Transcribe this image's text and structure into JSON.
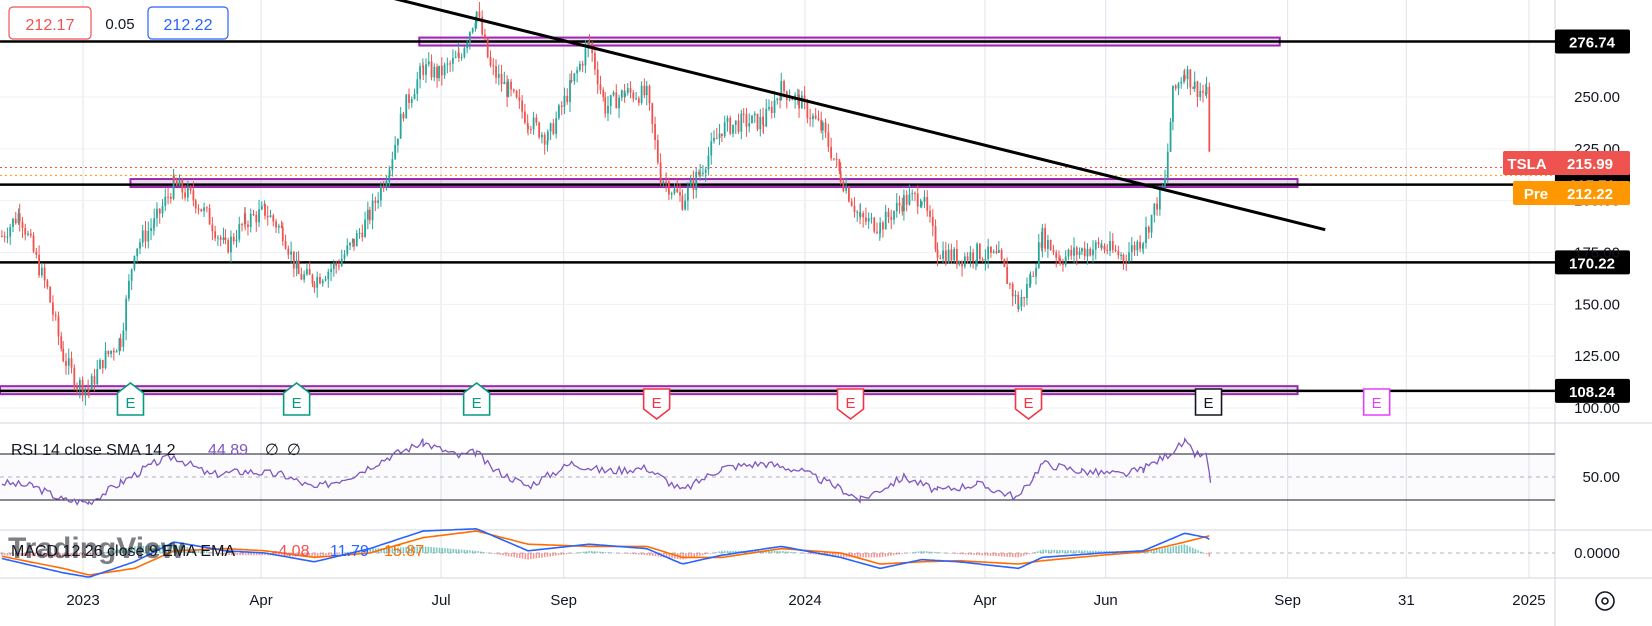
{
  "header": {
    "bid": "212.17",
    "spread": "0.05",
    "ask": "212.22"
  },
  "watermark": "TradingView",
  "colors": {
    "up": "#26a69a",
    "down": "#ef5350",
    "rsi": "#7e57c2",
    "macd": "#2962ff",
    "signal": "#ff6d00",
    "zone": "#9c27b0",
    "earnings_past_green": "#089981",
    "earnings_past_red": "#f23645",
    "earnings_future": "#e040fb"
  },
  "chart_data": [
    {
      "type": "candlestick",
      "symbol": "TSLA",
      "x_axis_labels": [
        "2023",
        "Apr",
        "Jul",
        "Sep",
        "2024",
        "Apr",
        "Jun",
        "Sep",
        "31",
        "2025"
      ],
      "y_ticks": [
        100,
        125,
        150,
        175,
        200,
        225,
        250
      ],
      "y_tick_labels": [
        "100.00",
        "125.00",
        "150.00",
        "175.00",
        "200.00",
        "225.00",
        "250.00"
      ],
      "ylim": [
        95,
        295
      ],
      "last_price_label": "215.99",
      "premarket_label": "Pre",
      "premarket_price": "212.22",
      "price_path": [
        [
          "2022-11-21",
          183
        ],
        [
          "2022-11-30",
          194
        ],
        [
          "2022-12-07",
          175
        ],
        [
          "2022-12-14",
          157
        ],
        [
          "2022-12-22",
          125
        ],
        [
          "2022-12-29",
          112
        ],
        [
          "2023-01-04",
          109
        ],
        [
          "2023-01-11",
          123
        ],
        [
          "2023-01-20",
          133
        ],
        [
          "2023-01-27",
          177
        ],
        [
          "2023-02-06",
          189
        ],
        [
          "2023-02-16",
          208
        ],
        [
          "2023-02-27",
          200
        ],
        [
          "2023-03-06",
          191
        ],
        [
          "2023-03-14",
          177
        ],
        [
          "2023-03-24",
          190
        ],
        [
          "2023-04-03",
          195
        ],
        [
          "2023-04-12",
          185
        ],
        [
          "2023-04-20",
          164
        ],
        [
          "2023-04-28",
          162
        ],
        [
          "2023-05-09",
          169
        ],
        [
          "2023-05-18",
          180
        ],
        [
          "2023-05-26",
          193
        ],
        [
          "2023-06-05",
          217
        ],
        [
          "2023-06-12",
          244
        ],
        [
          "2023-06-22",
          264
        ],
        [
          "2023-06-30",
          261
        ],
        [
          "2023-07-10",
          269
        ],
        [
          "2023-07-19",
          291
        ],
        [
          "2023-07-26",
          264
        ],
        [
          "2023-08-04",
          253
        ],
        [
          "2023-08-14",
          239
        ],
        [
          "2023-08-24",
          230
        ],
        [
          "2023-09-05",
          256
        ],
        [
          "2023-09-14",
          276
        ],
        [
          "2023-09-22",
          245
        ],
        [
          "2023-10-02",
          252
        ],
        [
          "2023-10-13",
          251
        ],
        [
          "2023-10-20",
          212
        ],
        [
          "2023-10-31",
          200
        ],
        [
          "2023-11-09",
          214
        ],
        [
          "2023-11-20",
          235
        ],
        [
          "2023-12-01",
          238
        ],
        [
          "2023-12-11",
          238
        ],
        [
          "2023-12-20",
          254
        ],
        [
          "2023-12-29",
          248
        ],
        [
          "2024-01-10",
          234
        ],
        [
          "2024-01-19",
          212
        ],
        [
          "2024-01-29",
          191
        ],
        [
          "2024-02-08",
          188
        ],
        [
          "2024-02-20",
          200
        ],
        [
          "2024-02-29",
          202
        ],
        [
          "2024-03-08",
          176
        ],
        [
          "2024-03-19",
          172
        ],
        [
          "2024-03-28",
          175
        ],
        [
          "2024-04-08",
          172
        ],
        [
          "2024-04-18",
          149
        ],
        [
          "2024-04-24",
          162
        ],
        [
          "2024-04-30",
          183
        ],
        [
          "2024-05-09",
          172
        ],
        [
          "2024-05-20",
          176
        ],
        [
          "2024-05-30",
          178
        ],
        [
          "2024-06-10",
          173
        ],
        [
          "2024-06-20",
          182
        ],
        [
          "2024-07-01",
          209
        ],
        [
          "2024-07-05",
          251
        ],
        [
          "2024-07-11",
          263
        ],
        [
          "2024-07-16",
          255
        ],
        [
          "2024-07-22",
          251
        ],
        [
          "2024-07-24",
          216
        ]
      ],
      "horizontal_levels": [
        {
          "value": 276.74,
          "label": "276.74"
        },
        {
          "value": 207.71,
          "label": "207.71"
        },
        {
          "value": 170.22,
          "label": "170.22"
        },
        {
          "value": 108.24,
          "label": "108.24"
        }
      ],
      "zones": [
        {
          "from": "2023-06-20",
          "to": "2024-08-28",
          "value": 276.74
        },
        {
          "from": "2023-01-25",
          "to": "2024-09-06",
          "value": 208.5
        },
        {
          "from": "2022-11-01",
          "to": "2024-09-06",
          "value": 108.6
        }
      ],
      "trendline": {
        "from": [
          "2023-05-15",
          303
        ],
        "to": [
          "2024-09-20",
          186
        ]
      },
      "earnings_markers": [
        {
          "date": "2023-01-25",
          "label": "E",
          "kind": "past-green"
        },
        {
          "date": "2023-04-19",
          "label": "E",
          "kind": "past-green"
        },
        {
          "date": "2023-07-19",
          "label": "E",
          "kind": "past-green"
        },
        {
          "date": "2023-10-18",
          "label": "E",
          "kind": "past-red"
        },
        {
          "date": "2024-01-24",
          "label": "E",
          "kind": "past-red"
        },
        {
          "date": "2024-04-23",
          "label": "E",
          "kind": "past-red"
        },
        {
          "date": "2024-07-23",
          "label": "E",
          "kind": "current"
        },
        {
          "date": "2024-10-16",
          "label": "E",
          "kind": "future"
        }
      ]
    },
    {
      "type": "line",
      "indicator": "RSI",
      "legend": "RSI 14 close SMA 14 2",
      "value_label": "44.89",
      "extra_labels": [
        "∅",
        "∅"
      ],
      "y_tick_labels": [
        "50.00"
      ],
      "ylim": [
        20,
        90
      ],
      "bands": [
        70,
        50,
        30
      ],
      "series": [
        {
          "name": "RSI",
          "points": [
            [
              "2022-11-21",
              45
            ],
            [
              "2022-12-07",
              42
            ],
            [
              "2022-12-22",
              30
            ],
            [
              "2023-01-04",
              28
            ],
            [
              "2023-01-20",
              45
            ],
            [
              "2023-02-06",
              62
            ],
            [
              "2023-02-16",
              68
            ],
            [
              "2023-03-06",
              52
            ],
            [
              "2023-03-24",
              55
            ],
            [
              "2023-04-12",
              52
            ],
            [
              "2023-04-28",
              40
            ],
            [
              "2023-05-18",
              52
            ],
            [
              "2023-06-05",
              68
            ],
            [
              "2023-06-22",
              80
            ],
            [
              "2023-07-10",
              68
            ],
            [
              "2023-07-19",
              72
            ],
            [
              "2023-07-26",
              58
            ],
            [
              "2023-08-14",
              42
            ],
            [
              "2023-09-05",
              62
            ],
            [
              "2023-09-22",
              55
            ],
            [
              "2023-10-13",
              58
            ],
            [
              "2023-10-31",
              38
            ],
            [
              "2023-11-20",
              58
            ],
            [
              "2023-12-11",
              62
            ],
            [
              "2023-12-29",
              56
            ],
            [
              "2024-01-19",
              40
            ],
            [
              "2024-01-29",
              30
            ],
            [
              "2024-02-20",
              50
            ],
            [
              "2024-03-08",
              38
            ],
            [
              "2024-03-28",
              44
            ],
            [
              "2024-04-18",
              32
            ],
            [
              "2024-04-30",
              62
            ],
            [
              "2024-05-20",
              55
            ],
            [
              "2024-06-10",
              52
            ],
            [
              "2024-06-20",
              57
            ],
            [
              "2024-07-01",
              68
            ],
            [
              "2024-07-11",
              80
            ],
            [
              "2024-07-16",
              70
            ],
            [
              "2024-07-22",
              68
            ],
            [
              "2024-07-24",
              45
            ]
          ]
        }
      ]
    },
    {
      "type": "histogram-line",
      "indicator": "MACD",
      "legend": "MACD 12 26 close 9 EMA EMA",
      "values": [
        "-4.08",
        "11.79",
        "15.87"
      ],
      "y_tick_labels": [
        "0.0000"
      ],
      "ylim": [
        -30,
        30
      ],
      "series": [
        {
          "name": "MACD",
          "points": [
            [
              "2022-11-21",
              -5
            ],
            [
              "2022-12-22",
              -18
            ],
            [
              "2023-01-04",
              -22
            ],
            [
              "2023-01-27",
              -8
            ],
            [
              "2023-02-16",
              10
            ],
            [
              "2023-03-14",
              2
            ],
            [
              "2023-04-03",
              0
            ],
            [
              "2023-04-28",
              -8
            ],
            [
              "2023-05-26",
              4
            ],
            [
              "2023-06-22",
              20
            ],
            [
              "2023-07-19",
              22
            ],
            [
              "2023-08-14",
              2
            ],
            [
              "2023-09-14",
              8
            ],
            [
              "2023-10-13",
              4
            ],
            [
              "2023-10-31",
              -10
            ],
            [
              "2023-11-20",
              -2
            ],
            [
              "2023-12-20",
              6
            ],
            [
              "2024-01-19",
              -4
            ],
            [
              "2024-02-08",
              -14
            ],
            [
              "2024-02-29",
              -6
            ],
            [
              "2024-03-19",
              -8
            ],
            [
              "2024-04-18",
              -14
            ],
            [
              "2024-04-30",
              -4
            ],
            [
              "2024-05-30",
              0
            ],
            [
              "2024-06-20",
              2
            ],
            [
              "2024-07-11",
              18
            ],
            [
              "2024-07-22",
              14
            ],
            [
              "2024-07-24",
              11.79
            ]
          ]
        },
        {
          "name": "Signal",
          "points": [
            [
              "2022-11-21",
              -3
            ],
            [
              "2022-12-22",
              -14
            ],
            [
              "2023-01-04",
              -20
            ],
            [
              "2023-01-27",
              -14
            ],
            [
              "2023-02-16",
              2
            ],
            [
              "2023-03-14",
              4
            ],
            [
              "2023-04-03",
              2
            ],
            [
              "2023-04-28",
              -4
            ],
            [
              "2023-05-26",
              0
            ],
            [
              "2023-06-22",
              14
            ],
            [
              "2023-07-19",
              20
            ],
            [
              "2023-08-14",
              8
            ],
            [
              "2023-09-14",
              6
            ],
            [
              "2023-10-13",
              6
            ],
            [
              "2023-10-31",
              -4
            ],
            [
              "2023-11-20",
              -4
            ],
            [
              "2023-12-20",
              4
            ],
            [
              "2024-01-19",
              0
            ],
            [
              "2024-02-08",
              -10
            ],
            [
              "2024-02-29",
              -8
            ],
            [
              "2024-03-19",
              -7
            ],
            [
              "2024-04-18",
              -10
            ],
            [
              "2024-04-30",
              -7
            ],
            [
              "2024-05-30",
              -2
            ],
            [
              "2024-06-20",
              1
            ],
            [
              "2024-07-11",
              10
            ],
            [
              "2024-07-22",
              15
            ],
            [
              "2024-07-24",
              15.87
            ]
          ]
        }
      ]
    }
  ]
}
